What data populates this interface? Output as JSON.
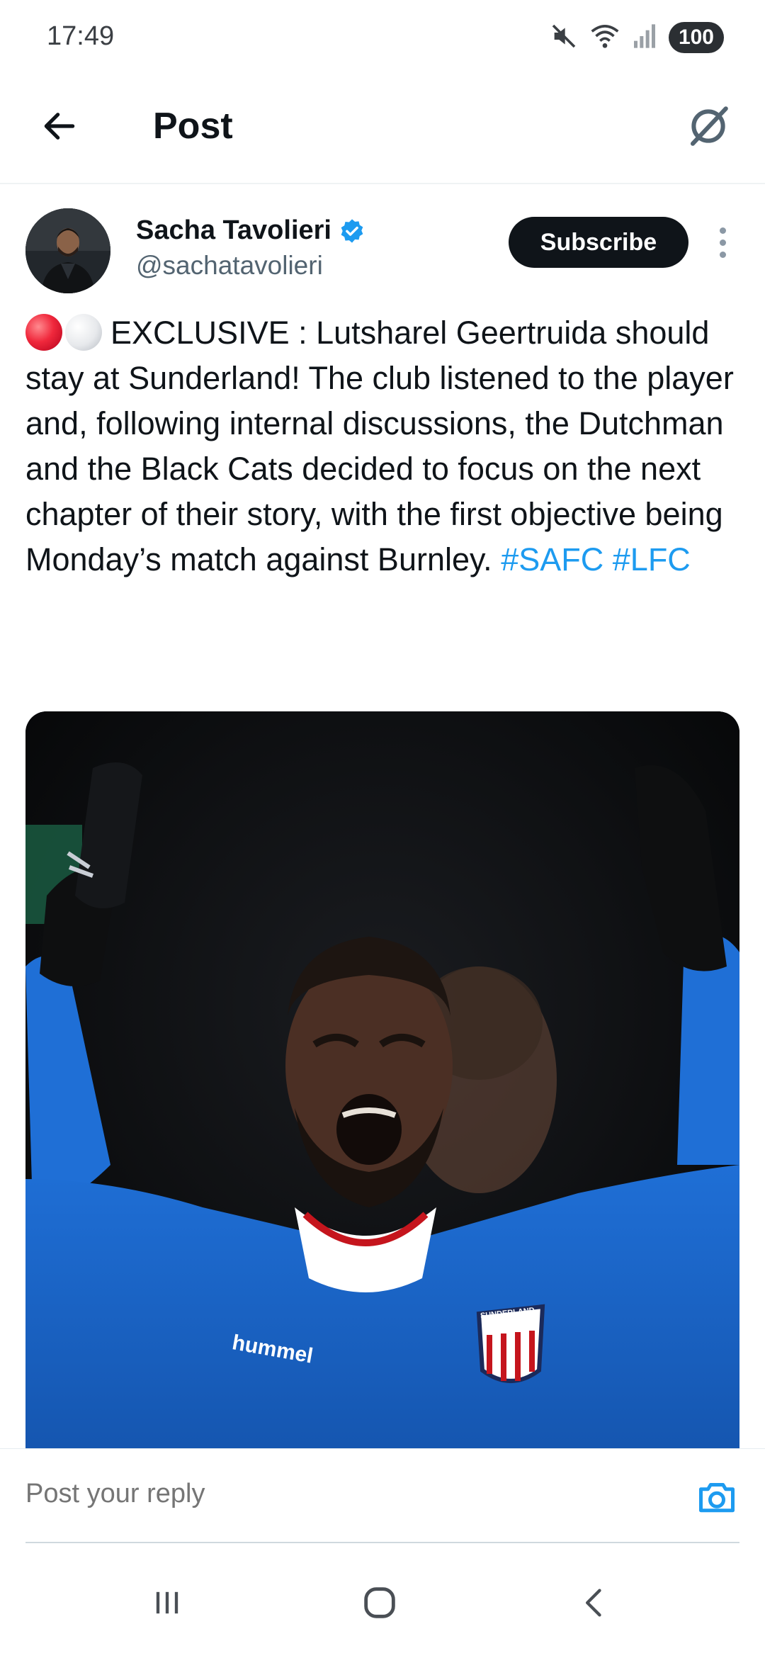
{
  "status_bar": {
    "time": "17:49",
    "battery": "100",
    "icons": [
      "mute-icon",
      "wifi-icon",
      "signal-icon"
    ]
  },
  "header": {
    "title": "Post",
    "back_icon": "arrow-left-icon",
    "grok_icon": "grok-icon"
  },
  "post": {
    "author_name": "Sacha Tavolieri",
    "author_handle": "@sachatavolieri",
    "verified": true,
    "subscribe_label": "Subscribe",
    "text": "EXCLUSIVE : Lutsharel Geertruida should stay at Sunderland! The club listened to the player and, following internal discussions, the Dutchman and the Black Cats decided to focus on the next chapter of their story, with the first objective being Monday’s match against Burnley.",
    "hashtags": [
      "#SAFC",
      "#LFC"
    ],
    "image_text": {
      "sponsor": "hummel",
      "crest": "SUNDERLAND"
    }
  },
  "reply": {
    "placeholder": "Post your reply"
  },
  "nav_bar": {
    "icons": [
      "recent-apps-icon",
      "home-icon",
      "back-icon"
    ]
  },
  "colors": {
    "accent": "#1d9bf0",
    "text": "#0f1419",
    "secondary_text": "#536471",
    "verified": "#1d9bf0"
  }
}
